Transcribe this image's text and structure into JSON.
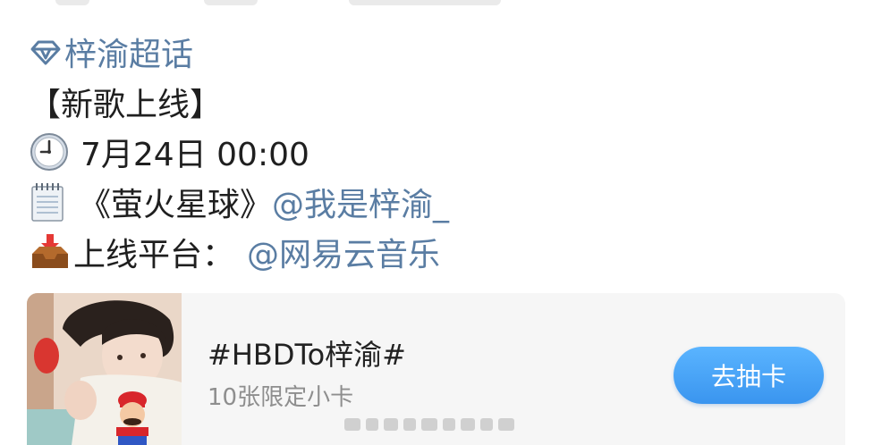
{
  "post": {
    "topic": "梓渝超话",
    "heading": "【新歌上线】",
    "datetime": "7月24日 00:00",
    "song_title": "《萤火星球》",
    "artist_mention": "@我是梓渝_",
    "platform_label": "上线平台：",
    "platform_mention": "@网易云音乐"
  },
  "card": {
    "title": "#HBDTo梓渝#",
    "subtitle": "10张限定小卡",
    "button_label": "去抽卡"
  },
  "colors": {
    "link": "#5a7da3",
    "button": "#4aa6f8",
    "card_bg": "#f6f6f6"
  },
  "icons": [
    "diamond-topic-icon",
    "clock-icon",
    "notepad-icon",
    "inbox-tray-icon",
    "mario-figure-icon"
  ]
}
